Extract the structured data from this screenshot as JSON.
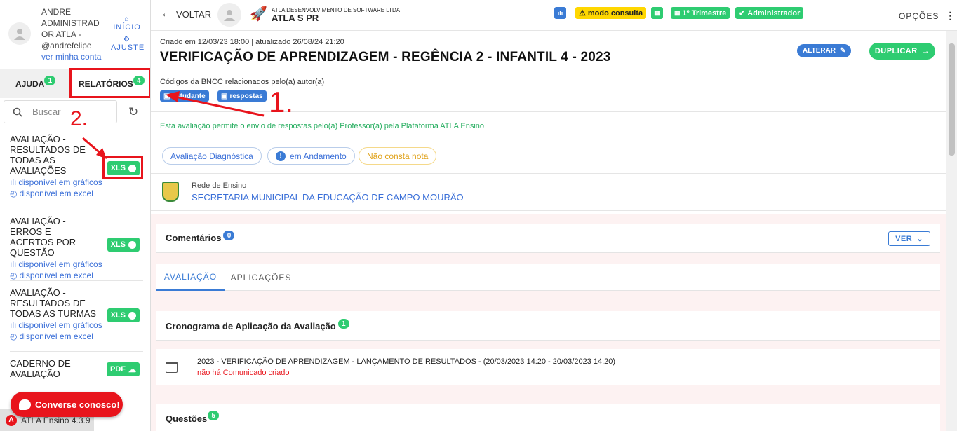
{
  "user": {
    "name_line1": "ANDRE",
    "name_line2": "ADMINISTRAD",
    "name_line3": "OR ATLA -",
    "handle": "@andrefelipe",
    "account_link": "ver minha conta"
  },
  "quick": {
    "home_label": "INÍCIO",
    "settings_label": "AJUSTE"
  },
  "tabs": {
    "help_label": "AJUDA",
    "help_count": "1",
    "reports_label": "RELATÓRIOS",
    "reports_count": "4"
  },
  "search": {
    "placeholder": "Buscar"
  },
  "reports": [
    {
      "title": "AVALIAÇÃO - RESULTADOS DE TODAS AS AVALIAÇÕES",
      "btn": "XLS",
      "link1": "disponível em gráficos",
      "link2": "disponível em excel"
    },
    {
      "title": "AVALIAÇÃO - ERROS E ACERTOS POR QUESTÃO",
      "btn": "XLS",
      "link1": "disponível em gráficos",
      "link2": "disponível em excel"
    },
    {
      "title": "AVALIAÇÃO - RESULTADOS DE TODAS AS TURMAS",
      "btn": "XLS",
      "link1": "disponível em gráficos",
      "link2": "disponível em excel"
    },
    {
      "title": "CADERNO DE AVALIAÇÃO",
      "btn": "PDF"
    }
  ],
  "chat": {
    "label": "Converse conosco!"
  },
  "version": {
    "label": "ATLA Ensino 4.3.9"
  },
  "annotations": {
    "one": "1.",
    "two": "2."
  },
  "topbar": {
    "back_label": "VOLTAR",
    "company_name": "ATLA DESENVOLVIMENTO DE SOFTWARE LTDA",
    "company_short": "ATLA S PR",
    "mode_label": "modo consulta",
    "term_label": "1º Trimestre",
    "role_label": "Administrador",
    "options_label": "OPÇÕES"
  },
  "page": {
    "meta": "Criado em 12/03/23 18:00 | atualizado 26/08/24 21:20",
    "title": "VERIFICAÇÃO DE APRENDIZAGEM - REGÊNCIA 2 - INFANTIL 4 - 2023",
    "edit_label": "ALTERAR",
    "duplicate_label": "DUPLICAR",
    "bncc_label": "Códigos da BNCC relacionados pelo(a) autor(a)",
    "chip_student": "estudante",
    "chip_answers": "respostas",
    "notice": "Esta avaliação permite o envio de respostas pelo(a) Professor(a) pela Plataforma ATLA Ensino",
    "tag_type": "Avaliação Diagnóstica",
    "tag_status": "em Andamento",
    "tag_grade": "Não consta nota",
    "network_label": "Rede de Ensino",
    "network_name": "SECRETARIA MUNICIPAL DA EDUCAÇÃO DE CAMPO MOURÃO",
    "comments_label": "Comentários",
    "comments_count": "0",
    "view_label": "VER",
    "tab_eval": "AVALIAÇÃO",
    "tab_apps": "APLICAÇÕES",
    "schedule_label": "Cronograma de Aplicação da Avaliação",
    "schedule_count": "1",
    "schedule_item": "2023 - VERIFICAÇÃO DE APRENDIZAGEM - LANÇAMENTO DE RESULTADOS - (20/03/2023 14:20 - 20/03/2023 14:20)",
    "schedule_note": "não há Comunicado criado",
    "questions_label": "Questões",
    "questions_count": "5"
  },
  "colors": {
    "accent": "#3a7bd5",
    "success": "#2ecc71",
    "warning": "#ffd700",
    "danger": "#e8141c",
    "bg_pink": "#fdf2f2"
  }
}
